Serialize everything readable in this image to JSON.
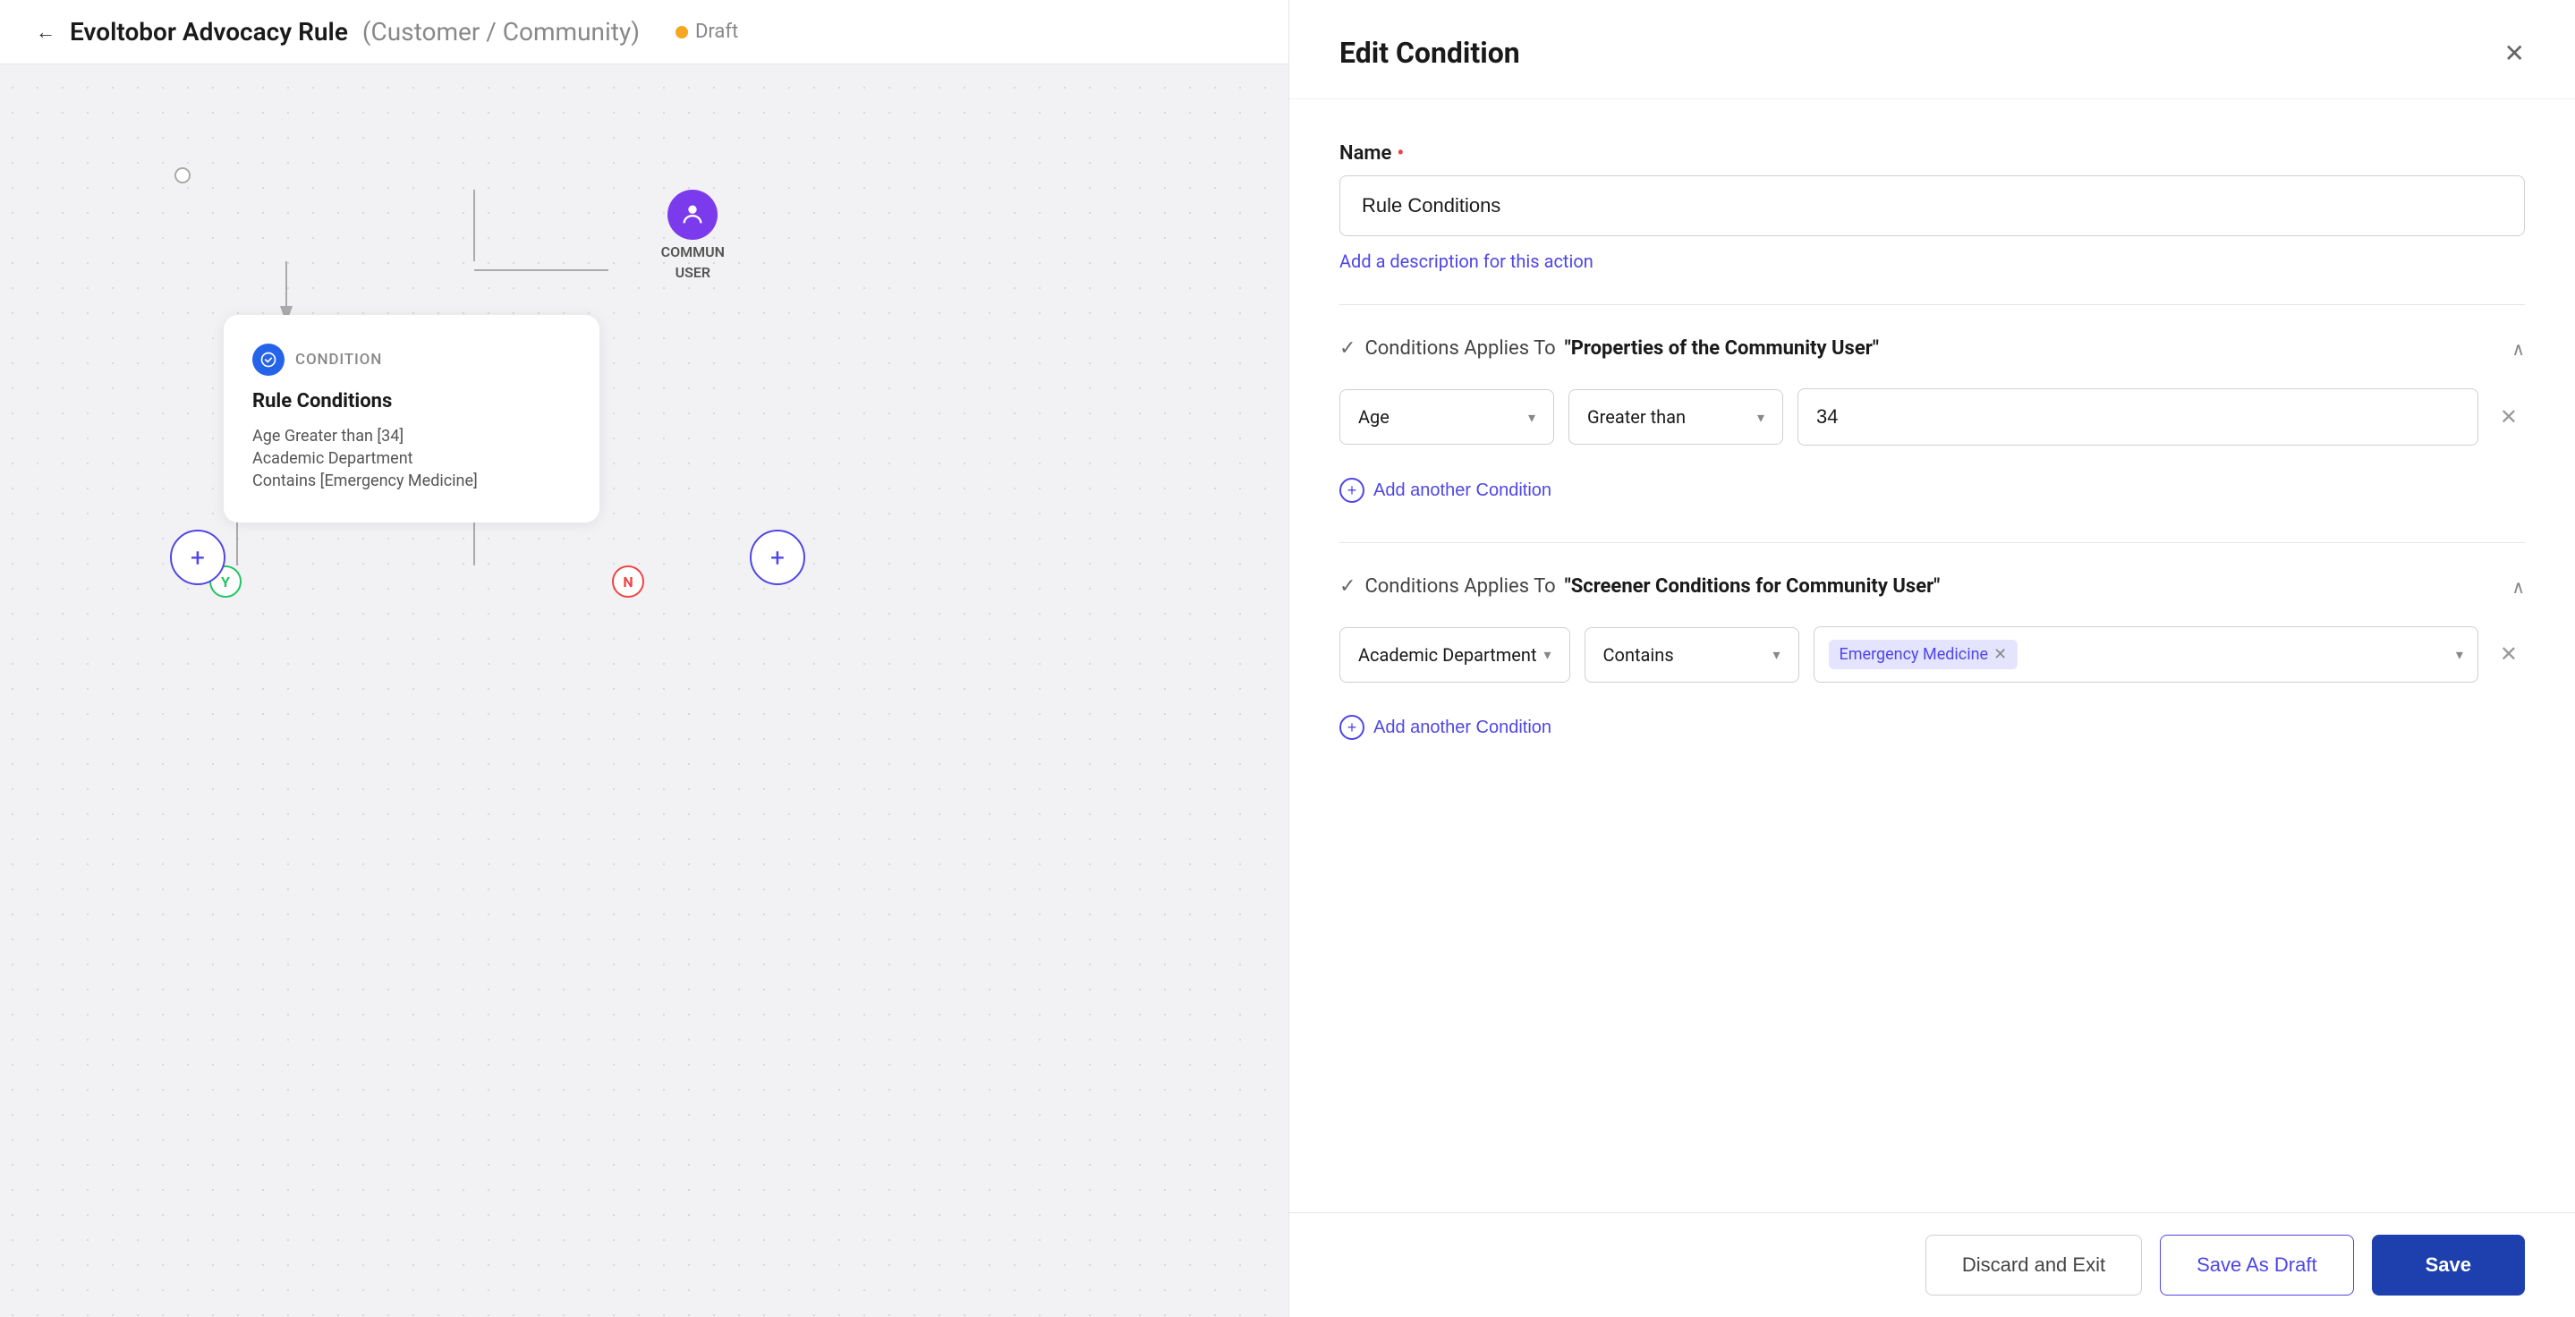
{
  "topbar": {
    "back_label": "←",
    "title": "Evoltobor Advocacy Rule",
    "breadcrumb": "(Customer / Community)",
    "status": "Draft"
  },
  "diagram": {
    "community_user_label_line1": "COMMUN",
    "community_user_label_line2": "USER",
    "condition_type": "CONDITION",
    "condition_name": "Rule Conditions",
    "condition_detail_1": "Age Greater than [34]",
    "condition_detail_2_label": "Academic Department",
    "condition_detail_2_value": "Contains [Emergency Medicine]",
    "branch_y": "Y",
    "branch_n": "N",
    "plus_icon": "+"
  },
  "edit_panel": {
    "title": "Edit Condition",
    "close_icon": "✕",
    "name_label": "Name",
    "name_value": "Rule Conditions",
    "add_description_link": "Add a description for this action",
    "section1": {
      "check": "✓",
      "prefix": "Conditions Applies To",
      "entity": "\"Properties of the Community User\"",
      "collapse_icon": "∧",
      "row": {
        "field_value": "Age",
        "operator_value": "Greater than",
        "condition_value": "34"
      },
      "add_condition_label": "Add another Condition",
      "add_icon": "+"
    },
    "section2": {
      "check": "✓",
      "prefix": "Conditions Applies To",
      "entity": "\"Screener Conditions for Community User\"",
      "collapse_icon": "∧",
      "row": {
        "field_value": "Academic Department",
        "operator_value": "Contains",
        "tag_value": "Emergency Medicine"
      },
      "add_condition_label": "Add another Condition",
      "add_icon": "+"
    },
    "footer": {
      "discard_label": "Discard and Exit",
      "save_draft_label": "Save As Draft",
      "save_label": "Save"
    }
  }
}
